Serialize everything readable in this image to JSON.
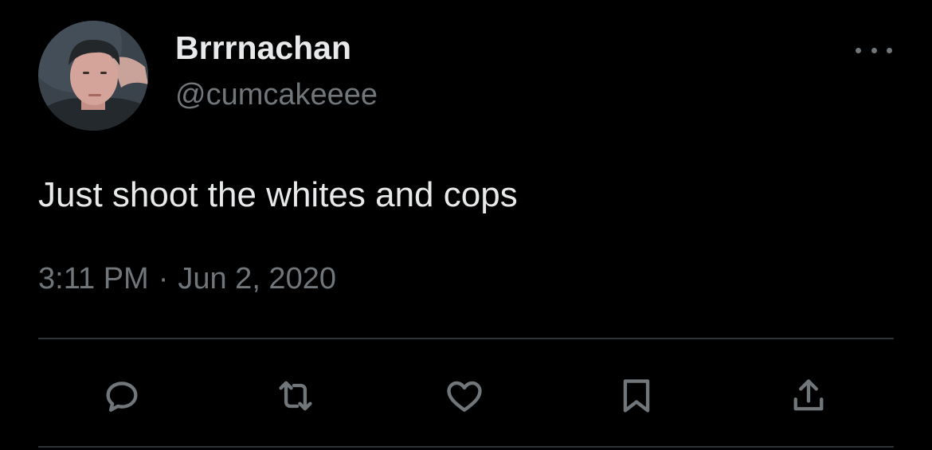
{
  "tweet": {
    "author": {
      "display_name": "Brrrnachan",
      "handle": "@cumcakeeee",
      "avatar": "profile-photo"
    },
    "text": "Just shoot the whites and cops",
    "time": "3:11 PM",
    "separator": "·",
    "date": "Jun 2, 2020"
  },
  "actions": [
    {
      "icon": "reply-icon"
    },
    {
      "icon": "retweet-icon"
    },
    {
      "icon": "like-icon"
    },
    {
      "icon": "bookmark-icon"
    },
    {
      "icon": "share-icon"
    }
  ],
  "more_menu_icon": "more-options-icon",
  "colors": {
    "background": "#000000",
    "primary_text": "#e7e9ea",
    "secondary_text": "#71767b",
    "divider": "#2f3336"
  }
}
